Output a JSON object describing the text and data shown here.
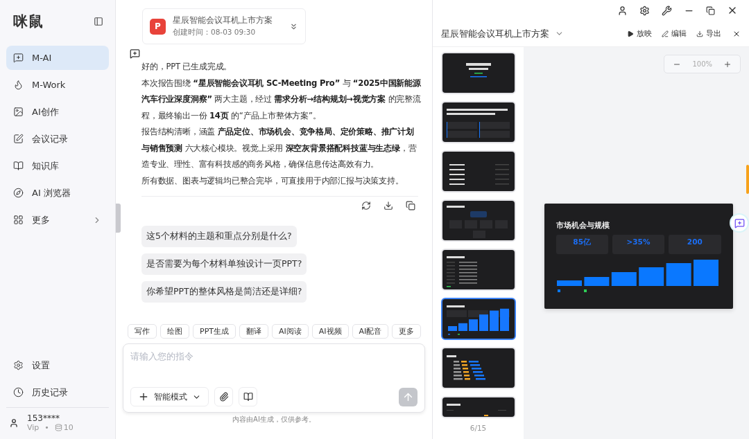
{
  "sidebar": {
    "logo": "咪鼠",
    "items": [
      {
        "label": "M-AI",
        "selected": true,
        "has_submenu": false
      },
      {
        "label": "M-Work",
        "selected": false,
        "has_submenu": false
      },
      {
        "label": "AI创作",
        "selected": false,
        "has_submenu": false
      },
      {
        "label": "会议记录",
        "selected": false,
        "has_submenu": false
      },
      {
        "label": "知识库",
        "selected": false,
        "has_submenu": false
      },
      {
        "label": "AI 浏览器",
        "selected": false,
        "has_submenu": false
      },
      {
        "label": "更多",
        "selected": false,
        "has_submenu": true
      }
    ],
    "bottom_items": [
      {
        "label": "设置"
      },
      {
        "label": "历史记录"
      }
    ],
    "user": {
      "name": "153****",
      "tier": "Vip",
      "separator": "•",
      "credits": "10"
    }
  },
  "chat": {
    "file_card": {
      "badge": "P",
      "title": "星辰智能会议耳机上市方案",
      "meta": "创建时间：08-03 09:30"
    },
    "reply": [
      "好的，PPT 已生成完成。",
      "本次报告围绕 **“星辰智能会议耳机 SC-Meeting Pro”** 与 **“2025中国新能源汽车行业深度洞察”** 两大主题，经过 **需求分析→结构规划→视觉方案** 的完整流程，最终输出一份 **14页** 的“产品上市整体方案”。",
      "报告结构清晰，涵盖 **产品定位、市场机会、竞争格局、定价策略、推广计划与销售预测** 六大核心模块。视觉上采用 **深空灰背景搭配科技蓝与生态绿**，营造专业、理性、富有科技感的商务风格，确保信息传达高效有力。",
      "所有数据、图表与逻辑均已整合完毕，可直接用于内部汇报与决策支持。"
    ],
    "suggestions": [
      "这5个材料的主题和重点分别是什么?",
      "是否需要为每个材料单独设计一页PPT?",
      "你希望PPT的整体风格是简洁还是详细?"
    ],
    "tools": [
      "写作",
      "绘图",
      "PPT生成",
      "翻译",
      "AI阅读",
      "AI视频",
      "AI配音",
      "更多"
    ],
    "input": {
      "placeholder": "请输入您的指令"
    },
    "mode": "智能模式",
    "disclaimer": "内容由AI生成，仅供参考。"
  },
  "preview": {
    "title": "星辰智能会议耳机上市方案",
    "actions": [
      "放映",
      "编辑",
      "导出"
    ],
    "thumbnails": [
      {
        "kind": "title",
        "selected": false
      },
      {
        "kind": "stats",
        "selected": false
      },
      {
        "kind": "list",
        "selected": false
      },
      {
        "kind": "cards",
        "selected": false
      },
      {
        "kind": "table",
        "selected": false
      },
      {
        "kind": "bars",
        "selected": true
      },
      {
        "kind": "hbars",
        "selected": false
      },
      {
        "kind": "timeline",
        "selected": false
      }
    ],
    "page": "6/15",
    "zoom": "100%",
    "slide": {
      "title": "市场机会与规模",
      "stats": [
        "85亿",
        ">35%",
        "200"
      ]
    }
  }
}
